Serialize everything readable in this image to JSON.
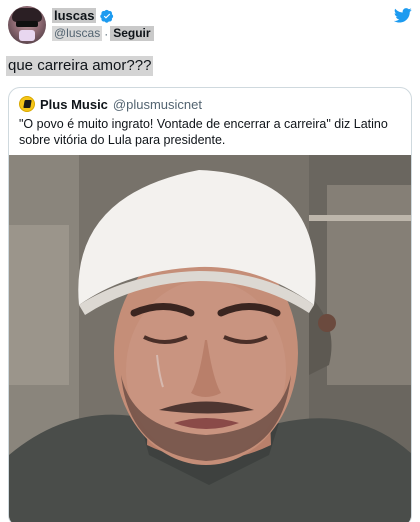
{
  "user": {
    "display_name": "luscas",
    "handle": "@luscas",
    "separator": "·",
    "follow_label": "Seguir"
  },
  "tweet": {
    "text": "que carreira amor???"
  },
  "quote": {
    "name": "Plus Music",
    "handle": "@plusmusicnet",
    "text": "\"O povo é muito ingrato! Vontade de encerrar a carreira\" diz Latino sobre vitória do Lula para presidente."
  },
  "colors": {
    "twitter_blue": "#1d9bf0",
    "verified_blue": "#1d9bf0",
    "border": "#cfd9de"
  },
  "icons": {
    "verified": "verified-badge-icon",
    "bird": "twitter-bird-icon"
  }
}
